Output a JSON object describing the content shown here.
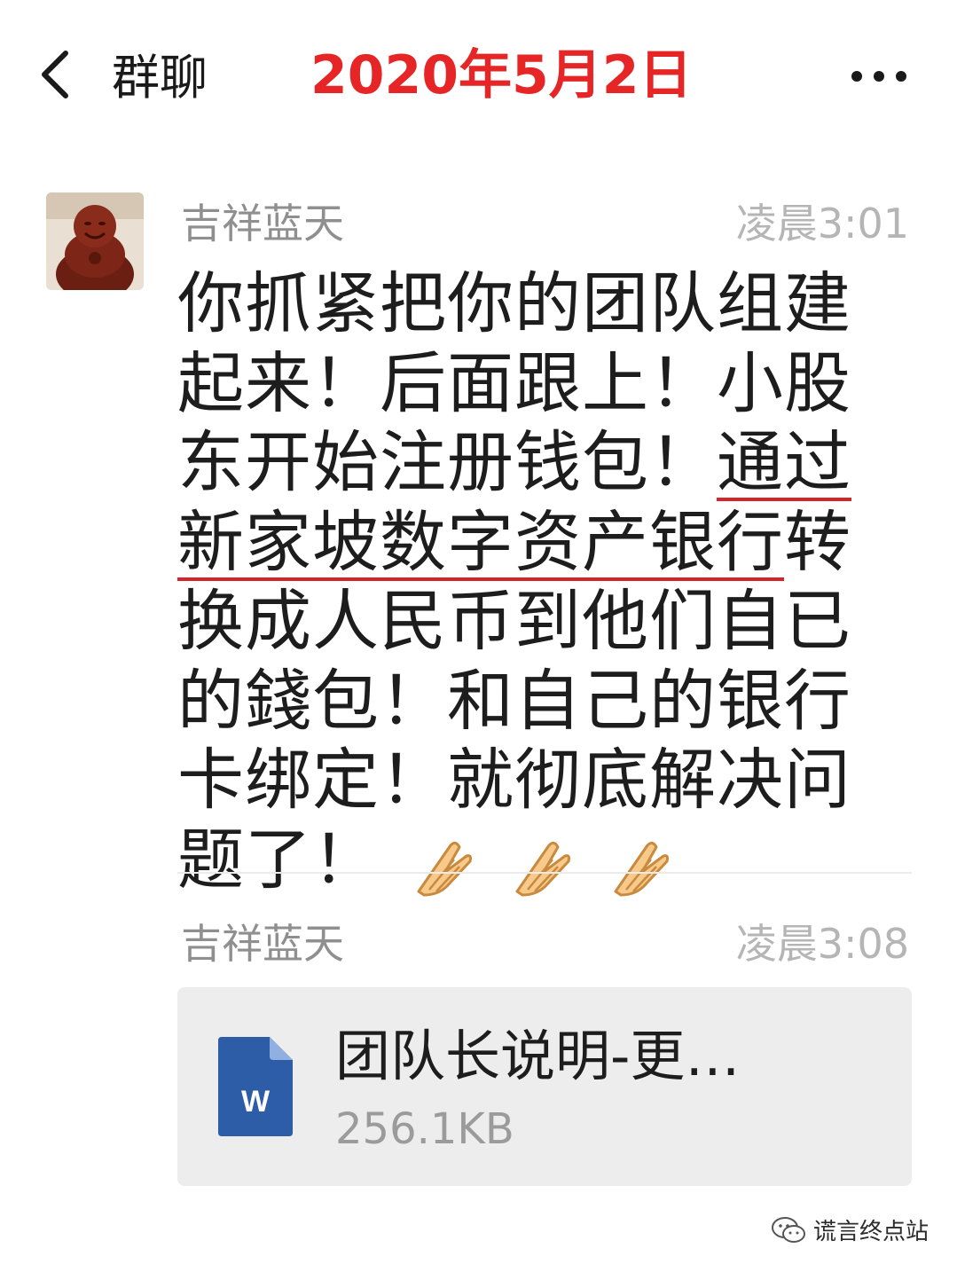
{
  "header": {
    "title": "群聊",
    "date": "2020年5月2日"
  },
  "messages": [
    {
      "sender": "吉祥蓝天",
      "time": "凌晨3:01",
      "text_before": "你抓紧把你的团队组建起来！后面跟上！小股东开始注册钱包！",
      "text_underlined": "通过新家坡数字资产银行",
      "text_after": "转换成人民币到他们自已的錢包！和自己的银行卡绑定！就彻底解决问题了！",
      "emoji": [
        "clap-hands-icon",
        "clap-hands-icon",
        "clap-hands-icon"
      ]
    },
    {
      "sender": "吉祥蓝天",
      "time": "凌晨3:08",
      "file": {
        "name": "团队长说明-更…",
        "size": "256.1KB",
        "icon": "word-document-icon",
        "icon_letter": "W"
      }
    }
  ],
  "watermark": {
    "text": "谎言终点站"
  },
  "colors": {
    "date_red": "#e62626",
    "underline_red": "#d6242b",
    "word_blue": "#2c5da6"
  }
}
